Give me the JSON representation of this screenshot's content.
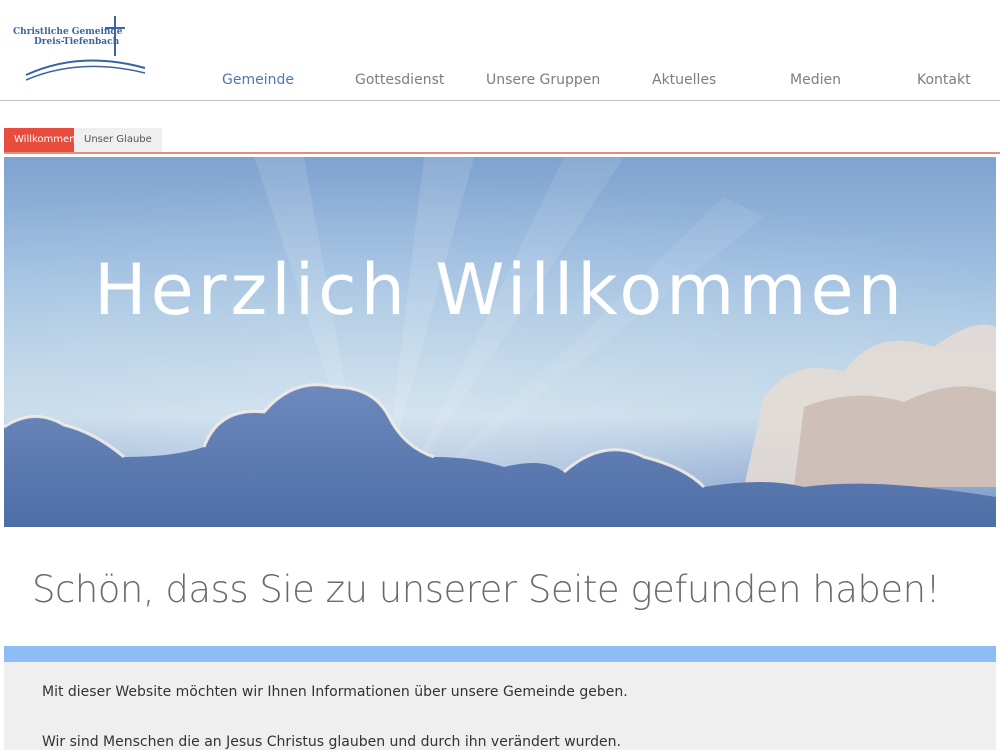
{
  "logo": {
    "line1": "Christliche Gemeinde",
    "line2": "Dreis-Tiefenbach"
  },
  "nav": {
    "items": [
      {
        "label": "Gemeinde",
        "active": true
      },
      {
        "label": "Gottesdienst",
        "active": false
      },
      {
        "label": "Unsere Gruppen",
        "active": false
      },
      {
        "label": "Aktuelles",
        "active": false
      },
      {
        "label": "Medien",
        "active": false
      },
      {
        "label": "Kontakt",
        "active": false
      }
    ]
  },
  "subnav": {
    "tabs": [
      {
        "label": "Willkommen",
        "active": true
      },
      {
        "label": "Unser Glaube",
        "active": false
      }
    ]
  },
  "hero": {
    "title": "Herzlich Willkommen"
  },
  "welcome": {
    "heading": "Schön, dass Sie zu unserer Seite gefunden haben!"
  },
  "info": {
    "paragraph1": "Mit dieser Website möchten wir Ihnen Informationen über unsere Gemeinde geben.",
    "paragraph2": "Wir sind Menschen die an Jesus Christus glauben und durch ihn verändert wurden."
  },
  "colors": {
    "nav_active": "#4f76b3",
    "nav_inactive": "#7d7d7d",
    "tab_active_bg": "#e84c3d",
    "accent_bar": "#8cbdf4",
    "info_bg": "#efefef"
  }
}
